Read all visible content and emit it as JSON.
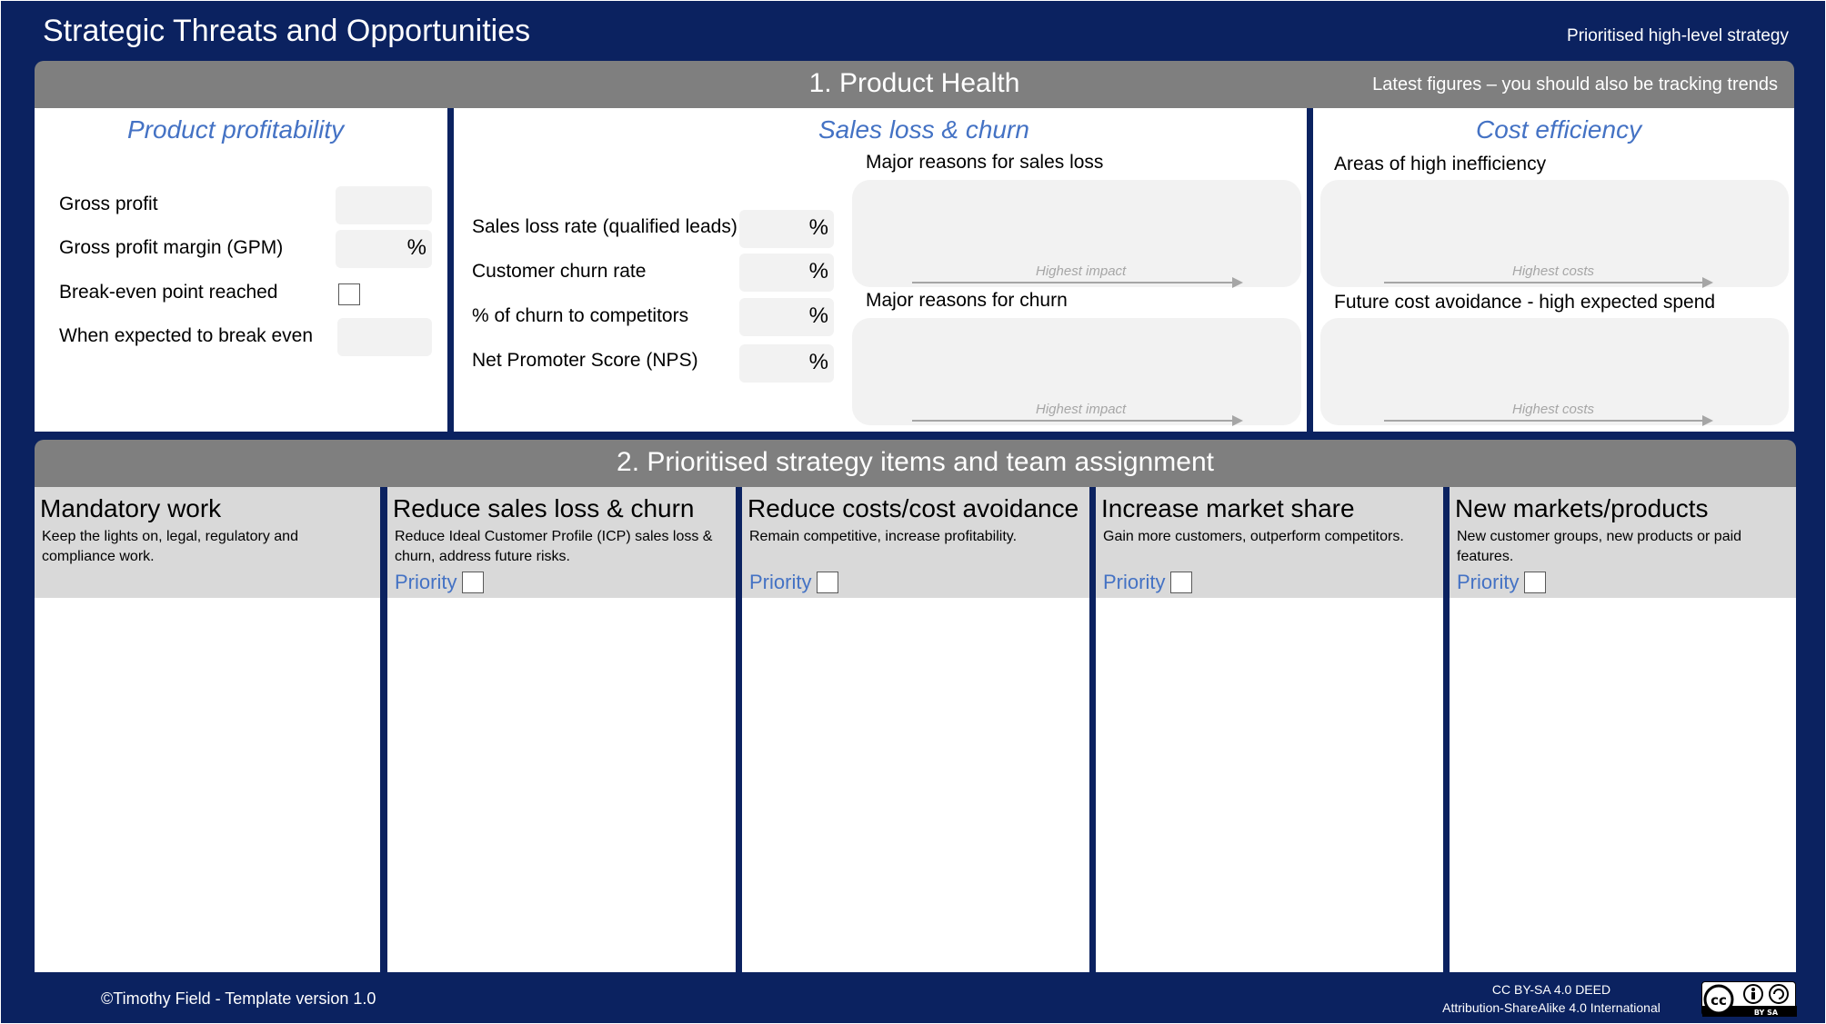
{
  "header": {
    "title": "Strategic Threats and Opportunities",
    "subtitle": "Prioritised high-level strategy"
  },
  "section1": {
    "title": "1. Product Health",
    "note": "Latest figures – you should also be tracking trends",
    "profitability": {
      "title": "Product profitability",
      "rows": [
        {
          "label": "Gross profit",
          "value": "",
          "unit": ""
        },
        {
          "label": "Gross profit margin (GPM)",
          "value": "",
          "unit": "%"
        },
        {
          "label": "Break-even point reached",
          "checked": false
        },
        {
          "label": "When expected to break even",
          "value": ""
        }
      ]
    },
    "sales": {
      "title": "Sales loss & churn",
      "rows": [
        {
          "label": "Sales loss rate (qualified leads)",
          "unit": "%"
        },
        {
          "label": "Customer churn rate",
          "unit": "%"
        },
        {
          "label": "% of churn to competitors",
          "unit": "%"
        },
        {
          "label": "Net Promoter Score (NPS)",
          "unit": "%"
        }
      ],
      "reasons": [
        {
          "label": "Major reasons for sales loss",
          "axis": "Highest impact"
        },
        {
          "label": "Major reasons for churn",
          "axis": "Highest impact"
        }
      ]
    },
    "cost": {
      "title": "Cost efficiency",
      "areas": [
        {
          "label": "Areas of high inefficiency",
          "axis": "Highest costs"
        },
        {
          "label": "Future cost avoidance - high expected spend",
          "axis": "Highest costs"
        }
      ]
    }
  },
  "section2": {
    "title": "2. Prioritised strategy items and team assignment",
    "priority_label": "Priority",
    "columns": [
      {
        "title": "Mandatory work",
        "description": "Keep the lights on, legal, regulatory and compliance work."
      },
      {
        "title": "Reduce sales loss & churn",
        "description": "Reduce Ideal Customer Profile (ICP) sales loss & churn, address future risks."
      },
      {
        "title": "Reduce costs/cost avoidance",
        "description": "Remain competitive, increase profitability."
      },
      {
        "title": "Increase market share",
        "description": "Gain more customers, outperform competitors."
      },
      {
        "title": "New markets/products",
        "description": "New customer groups, new products or paid features."
      }
    ]
  },
  "footer": {
    "copyright": "©Timothy Field - Template version 1.0",
    "license_line1": "CC BY-SA 4.0 DEED",
    "license_line2": "Attribution-ShareAlike 4.0 International",
    "license_logo_text": "BY SA"
  },
  "colors": {
    "background": "#0B2260",
    "banner": "#7F7F7F",
    "accent": "#4472C4",
    "column_header": "#D9D9D9",
    "field": "#F2F2F2"
  }
}
